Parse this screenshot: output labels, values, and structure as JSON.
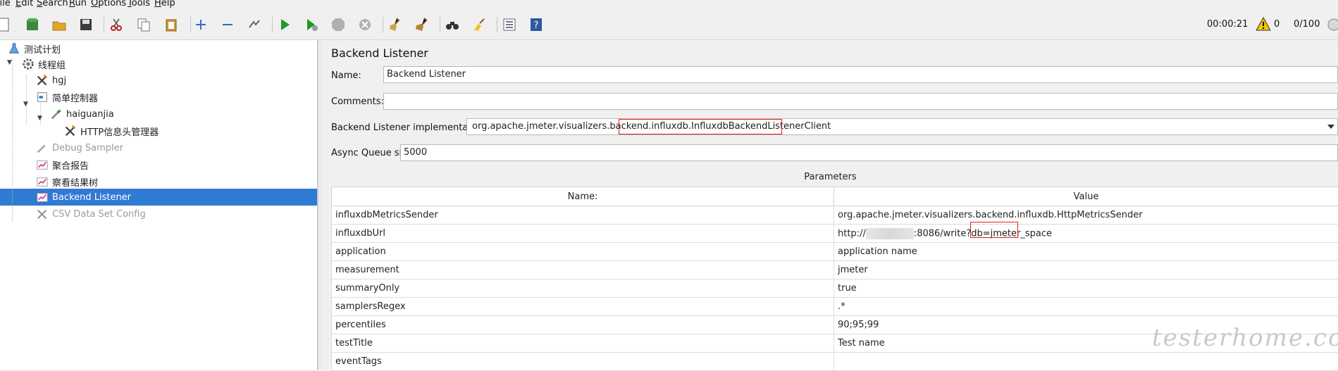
{
  "menu": [
    {
      "pre": "",
      "u": "F",
      "post": "ile"
    },
    {
      "pre": "",
      "u": "E",
      "post": "dit"
    },
    {
      "pre": "",
      "u": "S",
      "post": "earch"
    },
    {
      "pre": "",
      "u": "R",
      "post": "un"
    },
    {
      "pre": "",
      "u": "O",
      "post": "ptions"
    },
    {
      "pre": "",
      "u": "T",
      "post": "ools"
    },
    {
      "pre": "",
      "u": "H",
      "post": "elp"
    }
  ],
  "status": {
    "elapsed": "00:00:21",
    "warnings": "0",
    "threads": "0/100"
  },
  "tree": [
    {
      "label": "测试计划",
      "icon": "flask-icon"
    },
    {
      "label": "线程组",
      "icon": "gear-icon"
    },
    {
      "label": "hgj",
      "icon": "tools-icon"
    },
    {
      "label": "简单控制器",
      "icon": "controller-icon"
    },
    {
      "label": "haiguanjia",
      "icon": "pipette-icon"
    },
    {
      "label": "HTTP信息头管理器",
      "icon": "tools-icon"
    },
    {
      "label": "Debug Sampler",
      "icon": "pipette-icon"
    },
    {
      "label": "聚合报告",
      "icon": "chart-icon"
    },
    {
      "label": "察看结果树",
      "icon": "chart-icon"
    },
    {
      "label": "Backend Listener",
      "icon": "chart-icon"
    },
    {
      "label": "CSV Data Set Config",
      "icon": "tools-icon"
    }
  ],
  "panel": {
    "title": "Backend Listener",
    "name_label": "Name:",
    "name_value": "Backend Listener",
    "comments_label": "Comments:",
    "comments_value": "",
    "impl_label": "Backend Listener implementation",
    "impl_value": "org.apache.jmeter.visualizers.backend.influxdb.InfluxdbBackendListenerClient",
    "queue_label": "Async Queue size",
    "queue_value": "5000",
    "params_title": "Parameters",
    "col_name": "Name:",
    "col_value": "Value",
    "rows": [
      {
        "name": "influxdbMetricsSender",
        "value": "org.apache.jmeter.visualizers.backend.influxdb.HttpMetricsSender"
      },
      {
        "name": "influxdbUrl",
        "value_pre": "http://",
        "value_post": ":8086/write?db=jmeter_space"
      },
      {
        "name": "application",
        "value": "application name"
      },
      {
        "name": "measurement",
        "value": "jmeter"
      },
      {
        "name": "summaryOnly",
        "value": "true"
      },
      {
        "name": "samplersRegex",
        "value": ".*"
      },
      {
        "name": "percentiles",
        "value": "90;95;99"
      },
      {
        "name": "testTitle",
        "value": "Test name"
      },
      {
        "name": "eventTags",
        "value": ""
      }
    ]
  },
  "watermark": "testerhome.com"
}
